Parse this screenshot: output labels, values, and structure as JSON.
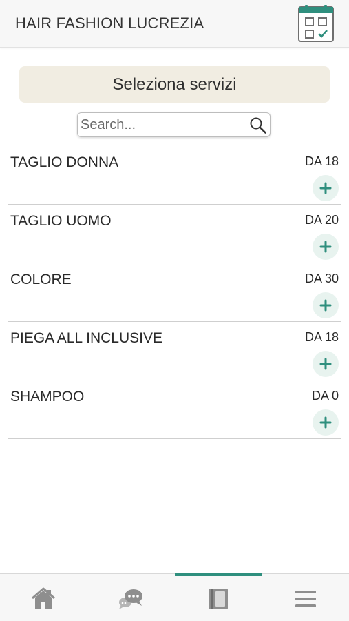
{
  "header": {
    "title": "HAIR FASHION LUCREZIA",
    "calendar_icon": "calendar-check-icon"
  },
  "section": {
    "title": "Seleziona servizi"
  },
  "search": {
    "placeholder": "Search...",
    "value": "",
    "icon": "search-icon"
  },
  "services": [
    {
      "name": "TAGLIO DONNA",
      "price": "DA 18"
    },
    {
      "name": "TAGLIO UOMO",
      "price": "DA 20"
    },
    {
      "name": "COLORE",
      "price": "DA 30"
    },
    {
      "name": "PIEGA ALL INCLUSIVE",
      "price": "DA 18"
    },
    {
      "name": "SHAMPOO",
      "price": "DA 0"
    }
  ],
  "bottom_nav": {
    "active_index": 2,
    "items": [
      {
        "icon": "home-icon"
      },
      {
        "icon": "chat-icon"
      },
      {
        "icon": "book-icon"
      },
      {
        "icon": "menu-icon"
      }
    ]
  },
  "colors": {
    "accent": "#2f8f7e",
    "banner": "#f1ede2",
    "add_button_bg": "#e8f3ef",
    "nav_icon": "#8e8e8e"
  }
}
